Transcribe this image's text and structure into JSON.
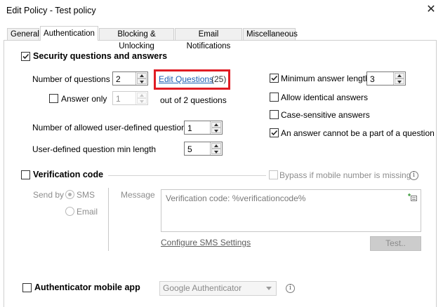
{
  "window": {
    "title": "Edit Policy - Test policy",
    "close_glyph": "✕"
  },
  "tabs": [
    {
      "label": "General"
    },
    {
      "label": "Authentication",
      "active": true
    },
    {
      "label": "Blocking & Unlocking"
    },
    {
      "label": "Email Notifications"
    },
    {
      "label": "Miscellaneous"
    }
  ],
  "security": {
    "enabled": true,
    "label": "Security questions and answers",
    "num_questions_label": "Number of questions",
    "num_questions_value": "2",
    "edit_questions_link": "Edit Questions",
    "edit_questions_count": "(25)",
    "answer_only_checked": false,
    "answer_only_label": "Answer only",
    "answer_only_value": "1",
    "out_of_text": "out of 2 questions",
    "user_defined_label": "Number of allowed user-defined questions",
    "user_defined_value": "1",
    "user_defined_min_label": "User-defined question min length",
    "user_defined_min_value": "5",
    "min_answer_length_checked": true,
    "min_answer_length_label": "Minimum answer length",
    "min_answer_length_value": "3",
    "allow_identical_checked": false,
    "allow_identical_label": "Allow identical answers",
    "case_sensitive_checked": false,
    "case_sensitive_label": "Case-sensitive answers",
    "not_part_checked": true,
    "not_part_label": "An answer cannot be a part of a question"
  },
  "verification": {
    "enabled": false,
    "label": "Verification code",
    "bypass_label": "Bypass if mobile number is missing",
    "send_by_label": "Send by",
    "sms_label": "SMS",
    "email_label": "Email",
    "selected": "SMS",
    "message_label": "Message",
    "message_value": "Verification code: %verificationcode%",
    "configure_link": "Configure SMS Settings",
    "test_button": "Test.."
  },
  "authenticator": {
    "enabled": false,
    "label": "Authenticator mobile app",
    "selected_app": "Google Authenticator"
  },
  "colors": {
    "highlight": "#e01c24",
    "link": "#1d5fb3"
  }
}
